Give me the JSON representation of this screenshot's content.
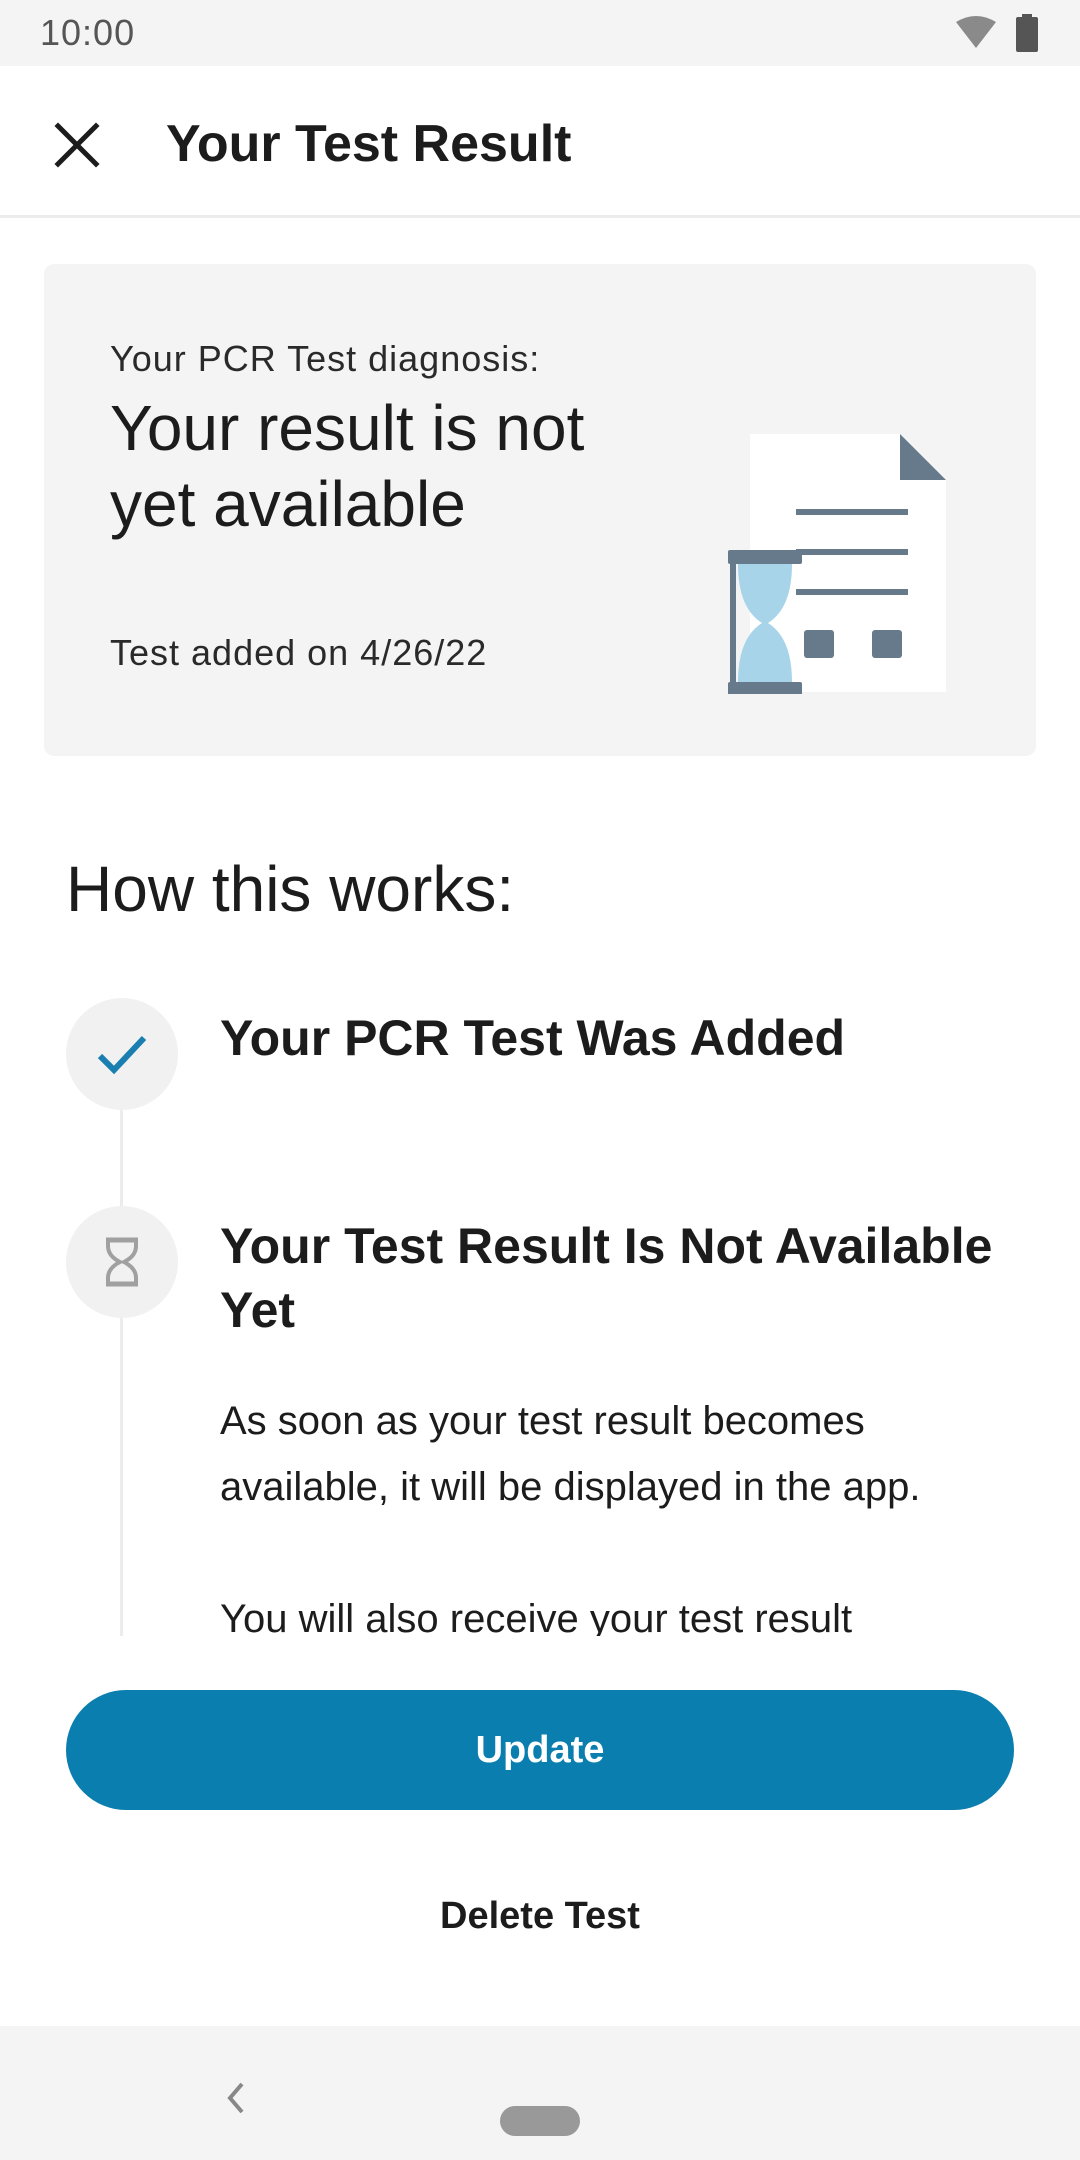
{
  "status_bar": {
    "time": "10:00",
    "icons": [
      "wifi-icon",
      "battery-icon"
    ]
  },
  "app_bar": {
    "title": "Your Test Result",
    "close_icon": "close-icon"
  },
  "result_card": {
    "label": "Your PCR Test diagnosis:",
    "heading": "Your result is not yet available",
    "date_text": "Test added on 4/26/22",
    "illustration": "document-hourglass-illustration"
  },
  "how_it_works": {
    "title": "How this works:",
    "steps": [
      {
        "title": "Your PCR Test Was Added",
        "icon": "checkmark-icon",
        "status": "complete"
      },
      {
        "title": "Your Test Result Is Not Available Yet",
        "icon": "hourglass-icon",
        "status": "pending",
        "body": [
          "As soon as your test result becomes available, it will be displayed in the app.",
          "You will also receive your test result"
        ]
      }
    ]
  },
  "actions": {
    "update_label": "Update",
    "delete_label": "Delete Test"
  },
  "colors": {
    "primary": "#0a7faf",
    "card_background": "#f4f4f4",
    "check_color": "#1a7fb0",
    "illustration_blue": "#a8d4ea",
    "illustration_slate": "#667a8c"
  },
  "nav_bar": {
    "back_icon": "back-chevron-icon",
    "home_icon": "home-pill-icon"
  }
}
